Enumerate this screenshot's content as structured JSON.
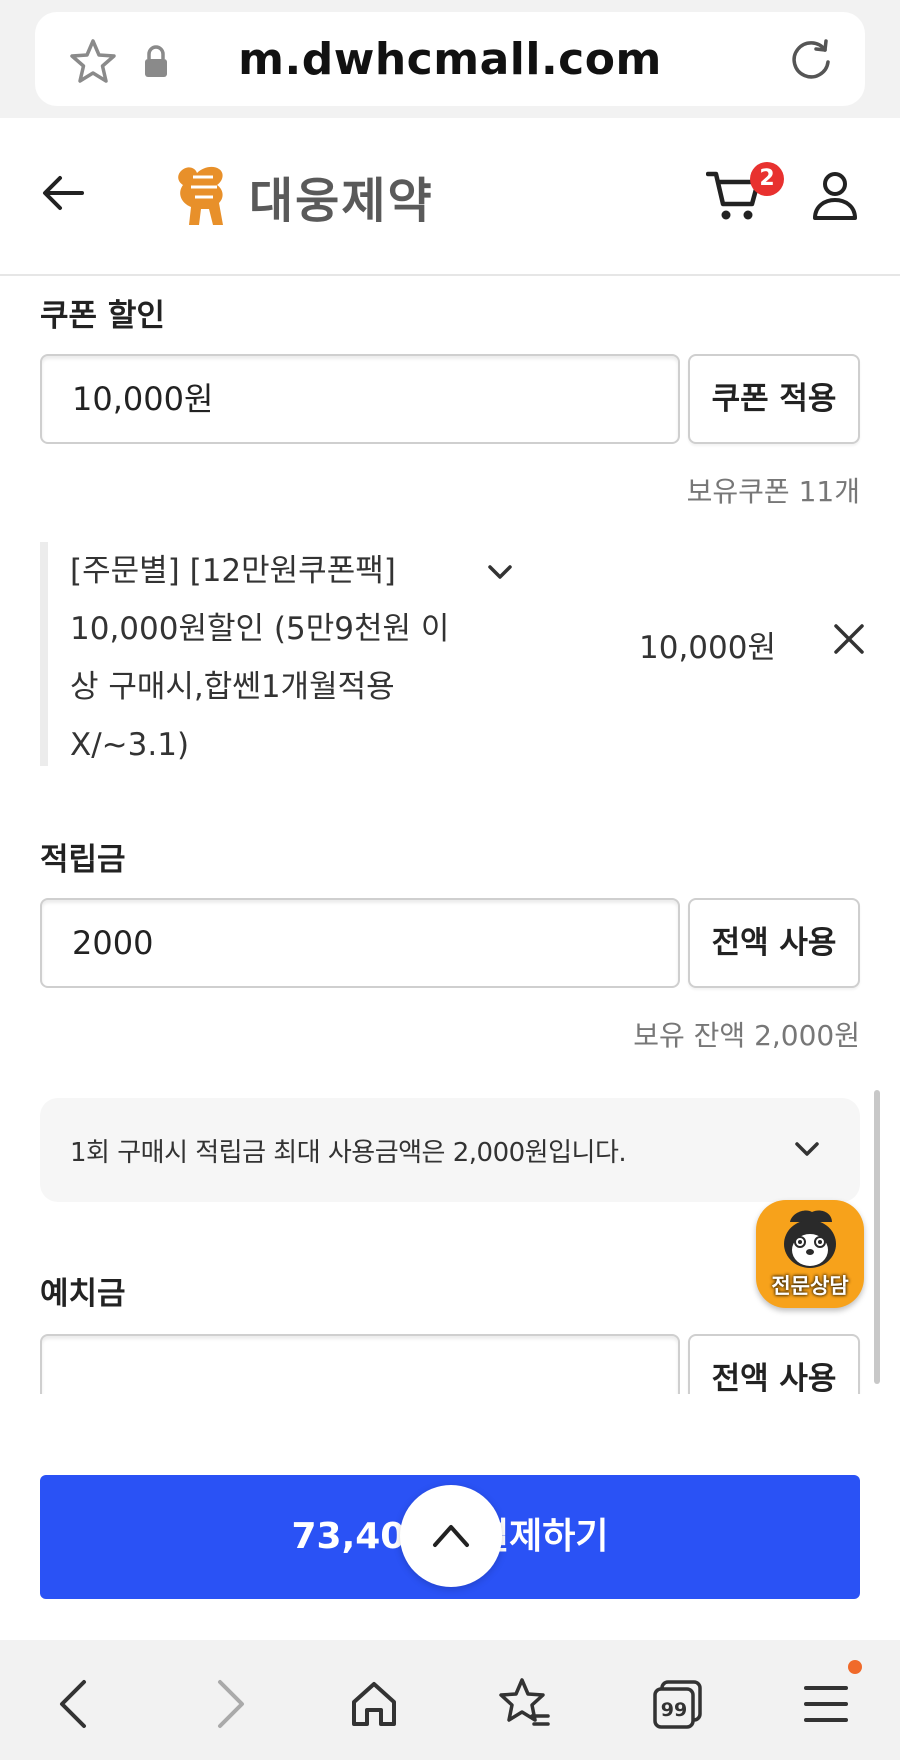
{
  "browser": {
    "url": "m.dwhcmall.com"
  },
  "header": {
    "logo_text": "대웅제약",
    "cart_count": "2"
  },
  "coupon": {
    "title": "쿠폰 할인",
    "input_value": "10,000원",
    "apply_label": "쿠폰 적용",
    "owned_text": "보유쿠폰 11개",
    "item": {
      "name": "[주문별] [12만원쿠폰팩] 10,000원할인 (5만9천원 이상 구매시,합쎈1개월적용X/~3.1)",
      "amount": "10,000원"
    }
  },
  "points": {
    "title": "적립금",
    "input_value": "2000",
    "use_all_label": "전액 사용",
    "balance_text": "보유 잔액 2,000원",
    "notice": "1회 구매시 적립금 최대 사용금액은 2,000원입니다."
  },
  "deposit": {
    "title": "예치금",
    "input_value": "",
    "use_all_label": "전액 사용"
  },
  "chat": {
    "label": "전문상담"
  },
  "pay": {
    "label": "73,400원 결제하기"
  },
  "bottom_nav": {
    "tabs_label": "99"
  },
  "colors": {
    "primary": "#2a52f5",
    "badge": "#e8312f",
    "logo": "#e8902a",
    "chat": "#f7a21b"
  }
}
